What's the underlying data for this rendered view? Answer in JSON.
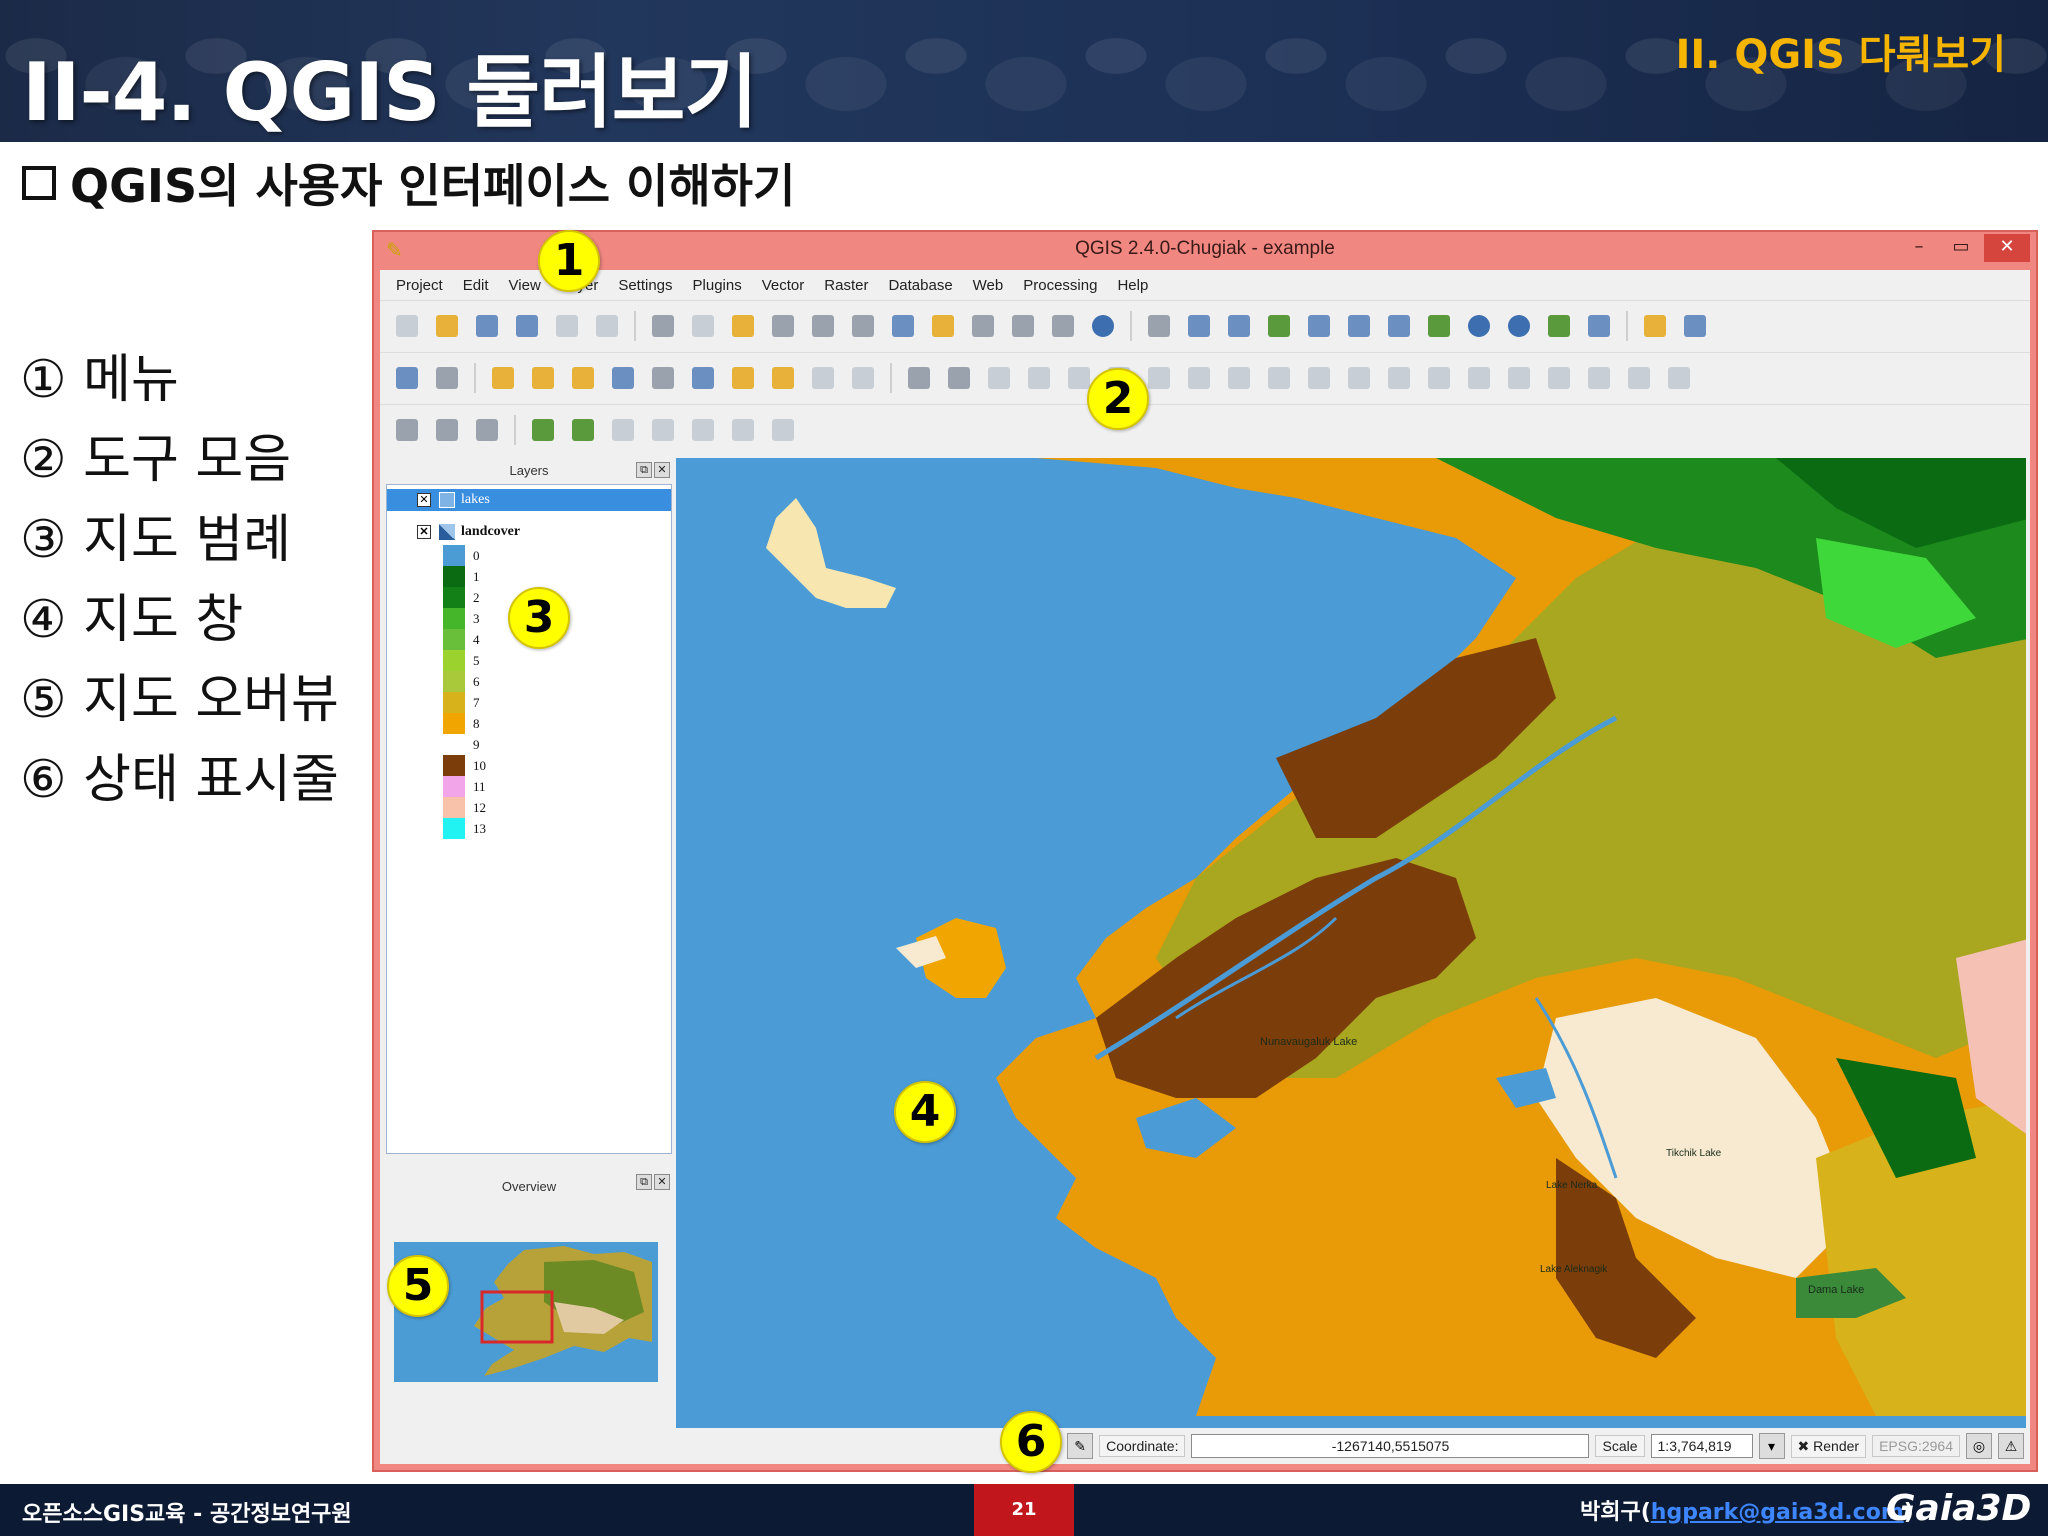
{
  "slide": {
    "title": "II-4. QGIS 둘러보기",
    "section": "II. QGIS 다뤄보기",
    "subtitle": "QGIS의 사용자 인터페이스 이해하기",
    "legend_items": [
      "① 메뉴",
      "② 도구 모음",
      "③ 지도 범례",
      "④ 지도 창",
      "⑤ 지도 오버뷰",
      "⑥ 상태 표시줄"
    ]
  },
  "qgis": {
    "window_title": "QGIS 2.4.0-Chugiak - example",
    "menu": [
      "Project",
      "Edit",
      "View",
      "Layer",
      "Settings",
      "Plugins",
      "Vector",
      "Raster",
      "Database",
      "Web",
      "Processing",
      "Help"
    ],
    "layers_panel_title": "Layers",
    "overview_panel_title": "Overview",
    "layers": [
      {
        "name": "lakes",
        "selected": true
      },
      {
        "name": "landcover",
        "selected": false
      }
    ],
    "landcover_classes": [
      {
        "label": "0",
        "color": "#4b9cd4"
      },
      {
        "label": "1",
        "color": "#0b6b12"
      },
      {
        "label": "2",
        "color": "#137f17"
      },
      {
        "label": "3",
        "color": "#45b52a"
      },
      {
        "label": "4",
        "color": "#6abf3a"
      },
      {
        "label": "5",
        "color": "#9cd22e"
      },
      {
        "label": "6",
        "color": "#a9c93a"
      },
      {
        "label": "7",
        "color": "#d7b21a"
      },
      {
        "label": "8",
        "color": "#f1a500"
      },
      {
        "label": "9",
        "color": "#ffffff"
      },
      {
        "label": "10",
        "color": "#7b3d09"
      },
      {
        "label": "11",
        "color": "#f2a5e9"
      },
      {
        "label": "12",
        "color": "#f7c1aa"
      },
      {
        "label": "13",
        "color": "#21f2f2"
      }
    ],
    "map_labels": [
      "Nunavaugaluk Lake",
      "Lake Aleknagik",
      "Lake Nerka",
      "Tikchik Lake",
      "Dama Lake"
    ],
    "status": {
      "coordinate_label": "Coordinate:",
      "coordinate_value": "-1267140,5515075",
      "scale_label": "Scale",
      "scale_value": "1:3,764,819",
      "render_label": "Render",
      "epsg": "EPSG:2964"
    }
  },
  "badges": [
    "1",
    "2",
    "3",
    "4",
    "5",
    "6"
  ],
  "footer": {
    "left": "오픈소스GIS교육 - 공간정보연구원",
    "page": "21",
    "author_name": "박희구(",
    "author_email": "hgpark@gaia3d.com",
    "author_close": ")",
    "logo": "Gaia3D"
  },
  "colors": {
    "header_bg": "#1b2a47",
    "section_label": "#f4b400",
    "qgis_titlebar": "#f08780",
    "badge": "#ffff00",
    "water": "#4a9bd6",
    "footer_bg": "#0c1a33",
    "page_box": "#c0161c"
  }
}
